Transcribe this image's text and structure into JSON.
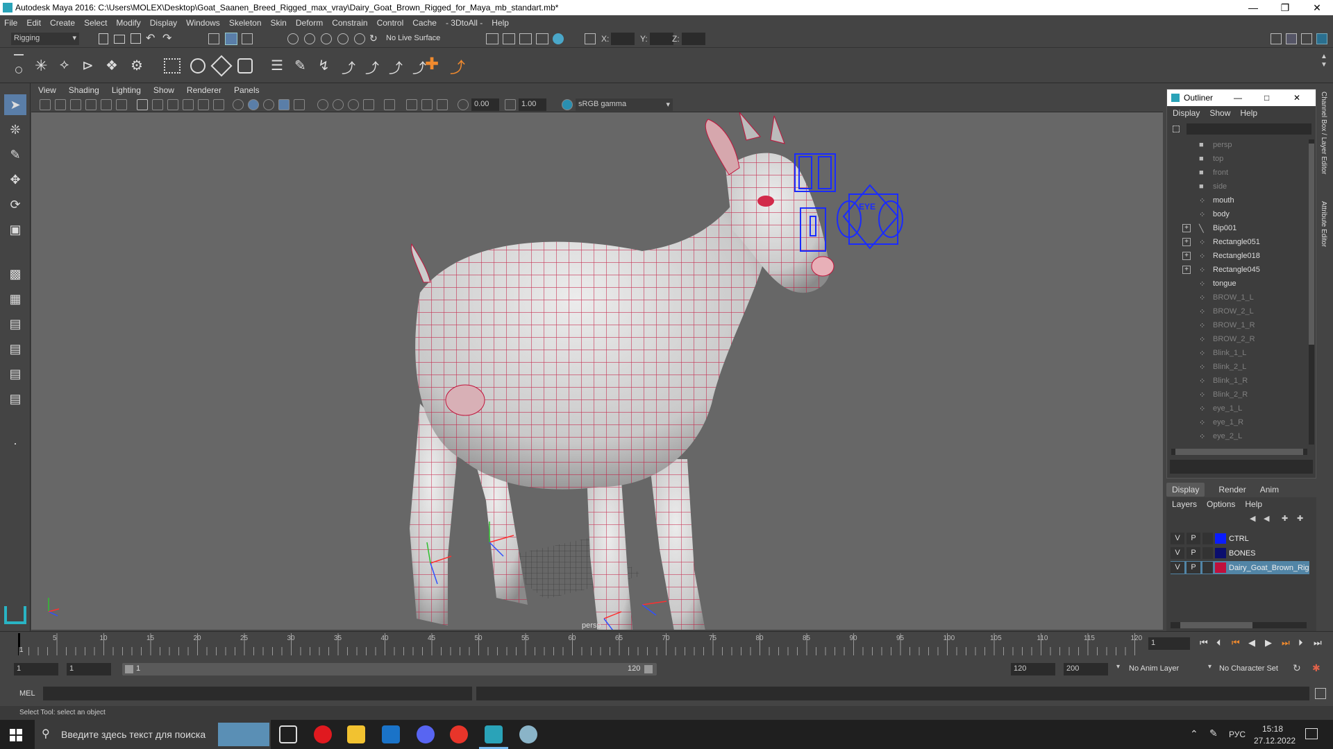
{
  "title_bar": {
    "title": "Autodesk Maya 2016: C:\\Users\\MOLEX\\Desktop\\Goat_Saanen_Breed_Rigged_max_vray\\Dairy_Goat_Brown_Rigged_for_Maya_mb_standart.mb*"
  },
  "menubar": {
    "items": [
      "File",
      "Edit",
      "Create",
      "Select",
      "Modify",
      "Display",
      "Windows",
      "Skeleton",
      "Skin",
      "Deform",
      "Constrain",
      "Control",
      "Cache",
      "- 3DtoAll -",
      "Help"
    ]
  },
  "status_line": {
    "mode": "Rigging",
    "live_surface": "No Live Surface",
    "x_label": "X:",
    "y_label": "Y:",
    "z_label": "Z:"
  },
  "panel_menu": {
    "items": [
      "View",
      "Shading",
      "Lighting",
      "Show",
      "Renderer",
      "Panels"
    ]
  },
  "panel_tools": {
    "exposure": "0.00",
    "gamma": "1.00",
    "color_space": "sRGB gamma"
  },
  "viewport": {
    "camera_label": "persp",
    "eye_label": "EYE"
  },
  "outliner": {
    "title": "Outliner",
    "menu": [
      "Display",
      "Show",
      "Help"
    ],
    "items": [
      {
        "label": "persp",
        "kind": "camera",
        "dim": true,
        "expandable": false
      },
      {
        "label": "top",
        "kind": "camera",
        "dim": true,
        "expandable": false
      },
      {
        "label": "front",
        "kind": "camera",
        "dim": true,
        "expandable": false
      },
      {
        "label": "side",
        "kind": "camera",
        "dim": true,
        "expandable": false
      },
      {
        "label": "mouth",
        "kind": "transform",
        "dim": false,
        "expandable": false
      },
      {
        "label": "body",
        "kind": "transform",
        "dim": false,
        "expandable": false
      },
      {
        "label": "Bip001",
        "kind": "joint",
        "dim": false,
        "expandable": true
      },
      {
        "label": "Rectangle051",
        "kind": "transform",
        "dim": false,
        "expandable": true
      },
      {
        "label": "Rectangle018",
        "kind": "transform",
        "dim": false,
        "expandable": true
      },
      {
        "label": "Rectangle045",
        "kind": "transform",
        "dim": false,
        "expandable": true
      },
      {
        "label": "tongue",
        "kind": "transform",
        "dim": false,
        "expandable": false
      },
      {
        "label": "BROW_1_L",
        "kind": "transform",
        "dim": true,
        "expandable": false
      },
      {
        "label": "BROW_2_L",
        "kind": "transform",
        "dim": true,
        "expandable": false
      },
      {
        "label": "BROW_1_R",
        "kind": "transform",
        "dim": true,
        "expandable": false
      },
      {
        "label": "BROW_2_R",
        "kind": "transform",
        "dim": true,
        "expandable": false
      },
      {
        "label": "Blink_1_L",
        "kind": "transform",
        "dim": true,
        "expandable": false
      },
      {
        "label": "Blink_2_L",
        "kind": "transform",
        "dim": true,
        "expandable": false
      },
      {
        "label": "Blink_1_R",
        "kind": "transform",
        "dim": true,
        "expandable": false
      },
      {
        "label": "Blink_2_R",
        "kind": "transform",
        "dim": true,
        "expandable": false
      },
      {
        "label": "eye_1_L",
        "kind": "transform",
        "dim": true,
        "expandable": false
      },
      {
        "label": "eye_1_R",
        "kind": "transform",
        "dim": true,
        "expandable": false
      },
      {
        "label": "eye_2_L",
        "kind": "transform",
        "dim": true,
        "expandable": false
      }
    ]
  },
  "layer_editor": {
    "tabs": [
      "Display",
      "Render",
      "Anim"
    ],
    "menu": [
      "Layers",
      "Options",
      "Help"
    ],
    "layers": [
      {
        "v": "V",
        "p": "P",
        "name": "CTRL",
        "color": "#0a1cff",
        "selected": false
      },
      {
        "v": "V",
        "p": "P",
        "name": "BONES",
        "color": "#0b0e6e",
        "selected": false
      },
      {
        "v": "V",
        "p": "P",
        "name": "Dairy_Goat_Brown_Rig",
        "color": "#c0103c",
        "selected": true
      }
    ]
  },
  "right_strip": {
    "tab1": "Channel Box / Layer Editor",
    "tab2": "Attribute Editor"
  },
  "timeline": {
    "ticks": [
      "5",
      "10",
      "15",
      "20",
      "25",
      "30",
      "35",
      "40",
      "45",
      "50",
      "55",
      "60",
      "65",
      "70",
      "75",
      "80",
      "85",
      "90",
      "95",
      "100",
      "105",
      "110",
      "115",
      "120"
    ],
    "current_frame_label": "1",
    "current_frame_field": "1"
  },
  "range_bar": {
    "start": "1",
    "playback_start": "1",
    "slider_start": "1",
    "slider_end": "120",
    "playback_end": "120",
    "end": "200",
    "anim_layer": "No Anim Layer",
    "char_set": "No Character Set"
  },
  "command_line": {
    "label": "MEL"
  },
  "help_line": {
    "text": "Select Tool: select an object"
  },
  "taskbar": {
    "search_placeholder": "Введите здесь текст для поиска",
    "lang": "РУС",
    "time": "15:18",
    "date": "27.12.2022"
  },
  "colors": {
    "wire": "#c2143c",
    "controls": "#1a2bff",
    "mesh": "#d9d9d9"
  }
}
